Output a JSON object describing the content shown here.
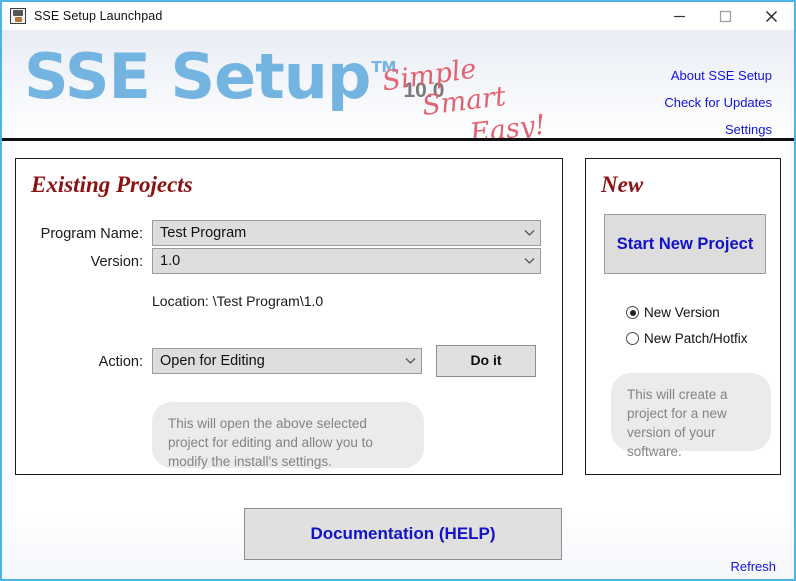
{
  "window": {
    "title": "SSE Setup Launchpad",
    "icon": "app-icon",
    "controls": {
      "minimize": "minimize-icon",
      "maximize": "maximize-icon",
      "close": "close-icon"
    },
    "border_color": "#4EB3E8"
  },
  "header": {
    "logo": "SSE Setup",
    "trademark": "TM",
    "version": "10.0",
    "logo_color": "#74B4E0",
    "tagline": {
      "line1": "Simple",
      "line2": "Smart",
      "line3": "Easy!",
      "color": "#E2636F"
    },
    "links": [
      {
        "label": "About SSE Setup"
      },
      {
        "label": "Check for Updates"
      },
      {
        "label": "Settings"
      }
    ],
    "link_color": "#1212E0"
  },
  "existing": {
    "title": "Existing Projects",
    "title_color": "#8C1212",
    "program_label": "Program Name:",
    "program_value": "Test Program",
    "version_label": "Version:",
    "version_value": "1.0",
    "location_text": "Location: \\Test Program\\1.0",
    "action_label": "Action:",
    "action_value": "Open for Editing",
    "do_it_label": "Do it",
    "hint": "This will open the above selected project for editing and allow you to modify the install's settings.",
    "chevron": "chevron-down-icon"
  },
  "new": {
    "title": "New",
    "title_color": "#8C1212",
    "start_button_label": "Start New Project",
    "start_button_color": "#1212C8",
    "radios": [
      {
        "label": "New Version",
        "selected": true
      },
      {
        "label": "New Patch/Hotfix",
        "selected": false
      }
    ],
    "hint": "This will create a project for a new version of your software."
  },
  "footer": {
    "documentation_label": "Documentation (HELP)",
    "documentation_color": "#1212C8",
    "refresh_label": "Refresh",
    "refresh_color": "#1212E0"
  }
}
